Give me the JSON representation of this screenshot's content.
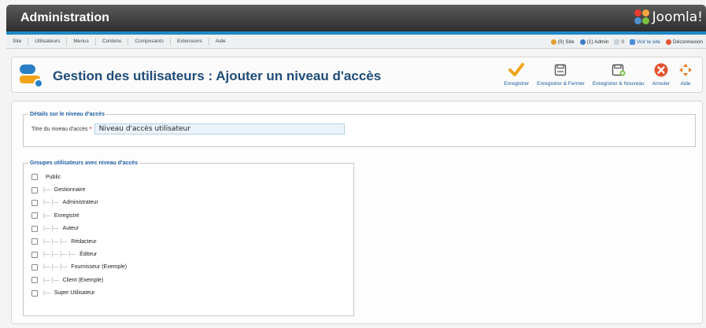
{
  "app": {
    "title": "Administration",
    "logo_text": "Joomla!"
  },
  "menu": {
    "items": [
      {
        "label": "Site"
      },
      {
        "label": "Utilisateurs"
      },
      {
        "label": "Menus"
      },
      {
        "label": "Contenu"
      },
      {
        "label": "Composants"
      },
      {
        "label": "Extensions"
      },
      {
        "label": "Aide"
      }
    ],
    "status": {
      "site": "(0) Site",
      "admin": "(1) Admin",
      "messages": "0",
      "view_site": "Voir le site",
      "logout": "Déconnexion"
    }
  },
  "page": {
    "title": "Gestion des utilisateurs : Ajouter un niveau d'accès"
  },
  "toolbar": {
    "save": "Enregistrer",
    "save_close": "Enregistrer & Fermer",
    "save_new": "Enregistrer & Nouveau",
    "cancel": "Annuler",
    "help": "Aide"
  },
  "details": {
    "legend": "Détails sur le niveau d'accès",
    "title_label": "Titre du niveau d'accès",
    "required_mark": "*",
    "title_value": "Niveau d'accès utilisateur"
  },
  "groups": {
    "legend": "Groupes utilisateurs avec niveau d'accès",
    "items": [
      {
        "prefix": "",
        "label": "Public"
      },
      {
        "prefix": "|— ",
        "label": "Gestionnaire"
      },
      {
        "prefix": "|— |— ",
        "label": "Administrateur"
      },
      {
        "prefix": "|— ",
        "label": "Enregistré"
      },
      {
        "prefix": "|— |— ",
        "label": "Auteur"
      },
      {
        "prefix": "|— |— |— ",
        "label": "Rédacteur"
      },
      {
        "prefix": "|— |— |— |— ",
        "label": "Éditeur"
      },
      {
        "prefix": "|— |— |— ",
        "label": "Fournisseur (Exemple)"
      },
      {
        "prefix": "|— |— ",
        "label": "Client (Exemple)"
      },
      {
        "prefix": "|— ",
        "label": "Super Utilisateur"
      }
    ]
  },
  "colors": {
    "accent": "#1e87c8",
    "title": "#1f4c78",
    "link": "#1f5ea0",
    "save_check": "#f2a41a",
    "cancel": "#e2532e",
    "help": "#f07b1a"
  },
  "icons": {
    "save": "checkmark-icon",
    "save_close": "save-close-icon",
    "save_new": "save-new-icon",
    "cancel": "cancel-icon",
    "help": "help-icon"
  }
}
